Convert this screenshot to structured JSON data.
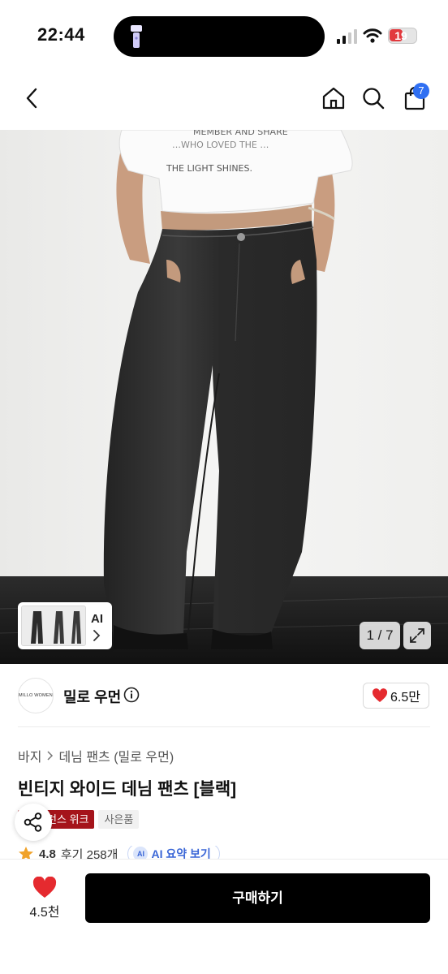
{
  "status_bar": {
    "time": "22:44",
    "battery": "19",
    "battery_level": 0.19,
    "icons": [
      "flashlight-icon",
      "signal-icon",
      "wifi-icon",
      "battery-icon"
    ]
  },
  "header": {
    "icons": [
      "back-icon",
      "home-icon",
      "search-icon",
      "shopping-bag-icon"
    ],
    "cart_badge": "7",
    "badge_color": "#2f6ff2"
  },
  "gallery": {
    "image_subject": "model wearing black wide denim pants and white graphic t-shirt",
    "tshirt_text": [
      "MEMBER AND SHARE",
      "WHO LOVED THE ...",
      "THE LIGHT SHINES."
    ],
    "thumb_label": "AI",
    "page_indicator": "1 / 7"
  },
  "brand": {
    "logo_text": "MILLO WOMEN",
    "name": "밀로 우먼",
    "likes": "6.5만"
  },
  "product": {
    "breadcrumb": [
      "바지",
      "데님 팬츠 (밀로 우먼)"
    ],
    "title": "빈티지 와이드 데님 팬츠 [블랙]",
    "tags": [
      "런스 위크",
      "사은품"
    ],
    "rating": "4.8",
    "reviews": "후기 258개",
    "ai_summary": "AI 요약 보기"
  },
  "bottom": {
    "like_count": "4.5천",
    "buy_label": "구매하기"
  },
  "colors": {
    "heart": "#e52a2f",
    "buy_button": "#000000",
    "tag_red": "#a5141b",
    "ai_blue": "#3a66d6"
  }
}
